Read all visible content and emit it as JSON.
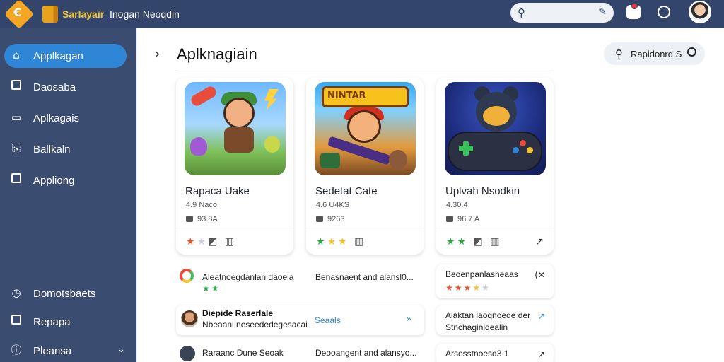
{
  "topbar": {
    "app_name": "Sarlayair",
    "subtitle": "Inogan Neoqdin",
    "logo_glyph": "€"
  },
  "sidebar": {
    "items": [
      {
        "label": "Applkagan",
        "icon": "home-icon",
        "active": true
      },
      {
        "label": "Daosaba",
        "icon": "square-icon",
        "active": false
      },
      {
        "label": "Aplkagais",
        "icon": "folder-icon",
        "active": false
      },
      {
        "label": "Ballkaln",
        "icon": "bookmark-icon",
        "active": false
      },
      {
        "label": "Appliong",
        "icon": "square-icon",
        "active": false
      }
    ],
    "bottom_items": [
      {
        "label": "Domotsbaets",
        "icon": "clock-icon"
      },
      {
        "label": "Repapa",
        "icon": "square-icon"
      },
      {
        "label": "Pleansa",
        "icon": "info-icon"
      }
    ]
  },
  "main": {
    "title": "Aplknagiain",
    "filter_label": "Rapidonrd S",
    "cards": [
      {
        "name": "Rapaca Uake",
        "rating": "4.9 Naco",
        "size": "93.8A",
        "stars": "★★ ◩ ▥"
      },
      {
        "name": "Sedetat Cate",
        "rating": "4.6 U4KS",
        "size": "9263",
        "stars": "★★★ ▥"
      },
      {
        "name": "Uplvah Nsodkin",
        "rating": "4.30.4",
        "size": "96.7 A",
        "stars": "★★ ◩ ▥"
      }
    ],
    "list": {
      "row1_left": "Aleatnoegdanlan daoela",
      "row1_mid": "Benasnaent and alansl0...",
      "row1_card": "Beoenpanlasneaas",
      "row2_title": "Diepide Raserlale",
      "row2_sub": "Nbeaanl neseededegesacai",
      "row2_link": "Seaals",
      "row2_card_t1": "Alaktan laoqnoede der",
      "row2_card_t2": "Stnchaginldealin",
      "row3_left": "Raraanc Dune Seoak",
      "row3_mid": "Deooangent and alansyo...",
      "row3_card": "Arsosstnoesd3 1"
    }
  },
  "colors": {
    "topbar": "#33456a",
    "sidebar": "#3a4c6f",
    "active": "#2f86d6",
    "star_gold": "#f2c230",
    "star_green": "#28a745",
    "star_orange": "#e8542c"
  }
}
